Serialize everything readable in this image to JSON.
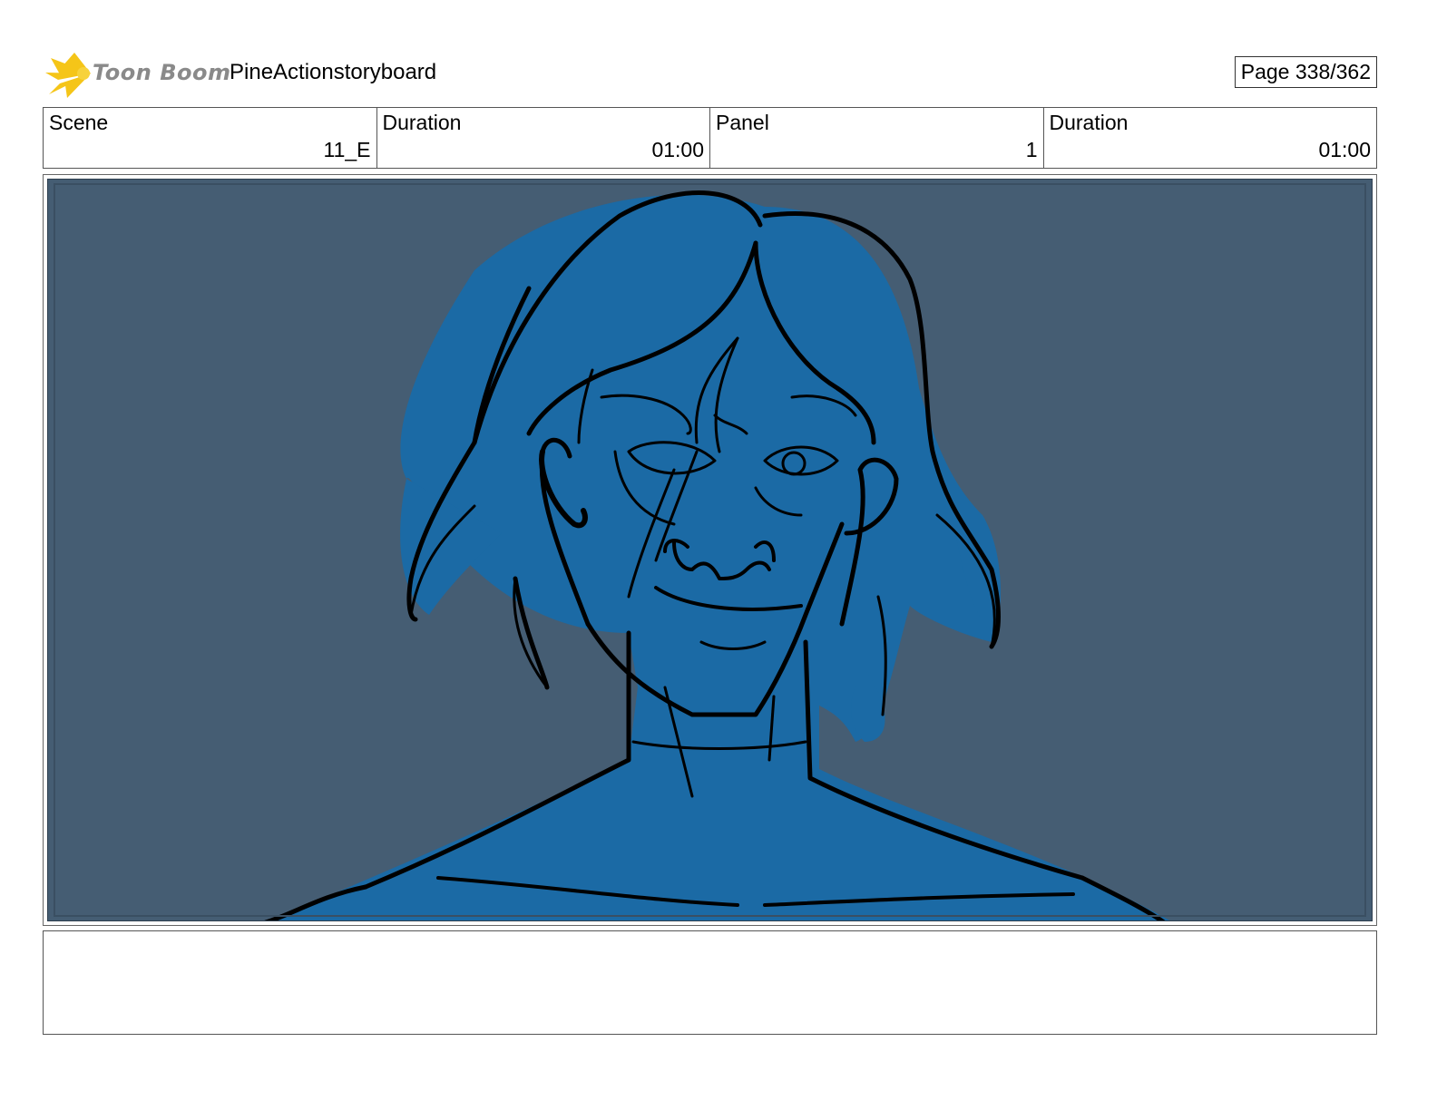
{
  "header": {
    "logo_text": "Toon Boom",
    "project_title": "PineActionstoryboard",
    "page_counter": "Page 338/362"
  },
  "info": {
    "scene_label": "Scene",
    "scene_value": "11_E",
    "scene_duration_label": "Duration",
    "scene_duration_value": "01:00",
    "panel_label": "Panel",
    "panel_value": "1",
    "panel_duration_label": "Duration",
    "panel_duration_value": "01:00"
  },
  "panel": {
    "background_color": "#455d73",
    "figure_color": "#1b6aa5",
    "line_color": "#000000"
  },
  "notes": {
    "text": ""
  }
}
